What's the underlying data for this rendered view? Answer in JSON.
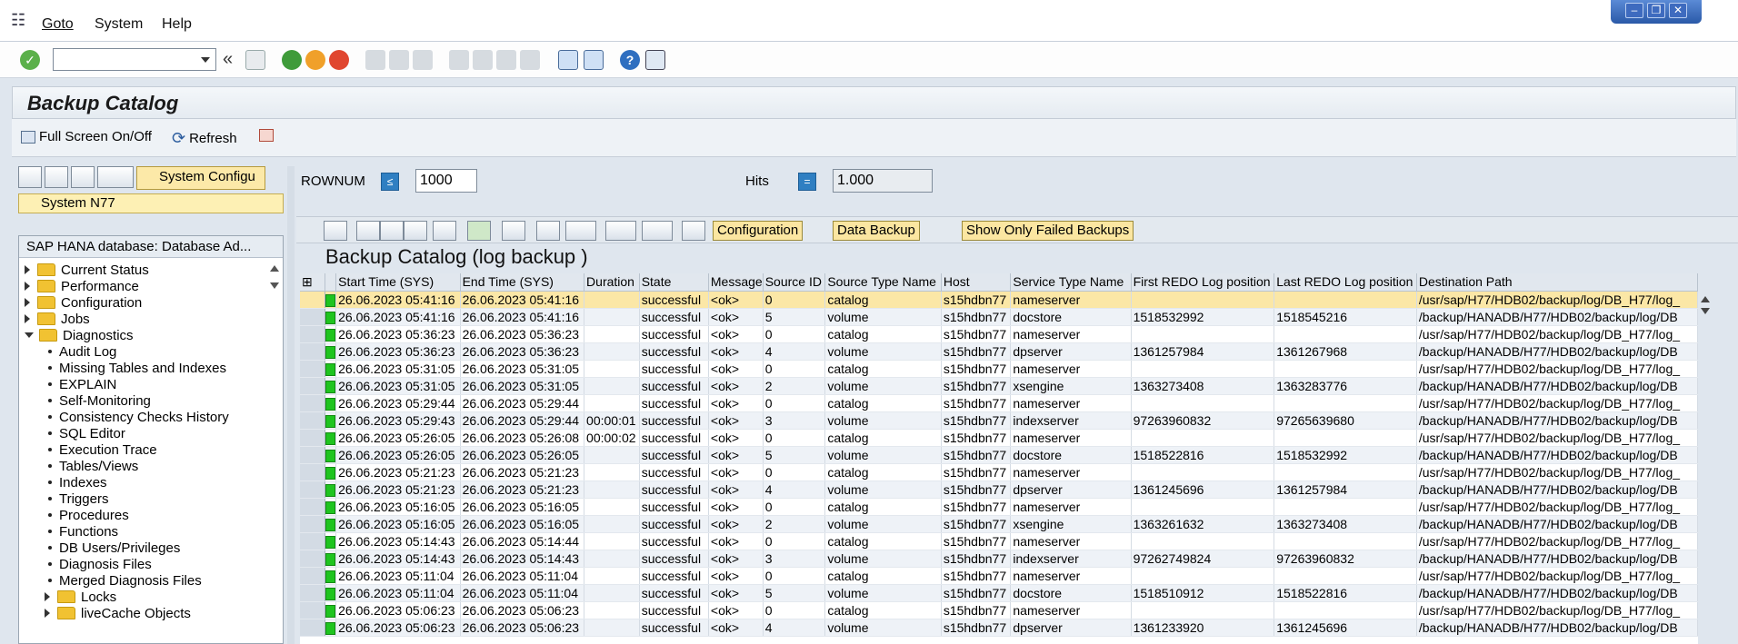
{
  "menubar": {
    "items": [
      "Goto",
      "System",
      "Help"
    ]
  },
  "window": {
    "title": "Backup Catalog"
  },
  "app_toolbar": {
    "fullscreen_label": "Full Screen On/Off",
    "refresh_label": "Refresh"
  },
  "left_pane": {
    "variant_label": "System Configu",
    "system_label": "System N77",
    "tree_header": "SAP HANA database: Database Ad...",
    "nodes": [
      {
        "label": "Current Status",
        "type": "folder"
      },
      {
        "label": "Performance",
        "type": "folder"
      },
      {
        "label": "Configuration",
        "type": "folder"
      },
      {
        "label": "Jobs",
        "type": "folder"
      },
      {
        "label": "Diagnostics",
        "type": "folder-open"
      },
      {
        "label": "Audit Log",
        "type": "leaf"
      },
      {
        "label": "Missing Tables and Indexes",
        "type": "leaf"
      },
      {
        "label": "EXPLAIN",
        "type": "leaf"
      },
      {
        "label": "Self-Monitoring",
        "type": "leaf"
      },
      {
        "label": "Consistency Checks History",
        "type": "leaf"
      },
      {
        "label": "SQL Editor",
        "type": "leaf"
      },
      {
        "label": "Execution Trace",
        "type": "leaf"
      },
      {
        "label": "Tables/Views",
        "type": "leaf"
      },
      {
        "label": "Indexes",
        "type": "leaf"
      },
      {
        "label": "Triggers",
        "type": "leaf"
      },
      {
        "label": "Procedures",
        "type": "leaf"
      },
      {
        "label": "Functions",
        "type": "leaf"
      },
      {
        "label": "DB Users/Privileges",
        "type": "leaf"
      },
      {
        "label": "Diagnosis Files",
        "type": "leaf"
      },
      {
        "label": "Merged Diagnosis Files",
        "type": "leaf"
      },
      {
        "label": "Locks",
        "type": "subfolder"
      },
      {
        "label": "liveCache Objects",
        "type": "subfolder"
      }
    ]
  },
  "filter": {
    "rownum_label": "ROWNUM",
    "rownum_value": "1000",
    "hits_label": "Hits",
    "hits_value": "1.000"
  },
  "grid_toolbar": {
    "configuration": "Configuration",
    "data_backup": "Data Backup",
    "failed_only": "Show Only Failed Backups"
  },
  "grid": {
    "title": "Backup Catalog (log backup )",
    "columns": [
      "Start Time (SYS)",
      "End Time (SYS)",
      "Duration",
      "State",
      "Message",
      "Source ID",
      "Source Type Name",
      "Host",
      "Service Type Name",
      "First REDO Log position",
      "Last REDO Log position",
      "Destination Path"
    ],
    "rows": [
      [
        "26.06.2023 05:41:16",
        "26.06.2023 05:41:16",
        "",
        "successful",
        "<ok>",
        "0",
        "catalog",
        "s15hdbn77",
        "nameserver",
        "",
        "",
        "/usr/sap/H77/HDB02/backup/log/DB_H77/log_"
      ],
      [
        "26.06.2023 05:41:16",
        "26.06.2023 05:41:16",
        "",
        "successful",
        "<ok>",
        "5",
        "volume",
        "s15hdbn77",
        "docstore",
        "1518532992",
        "1518545216",
        "/backup/HANADB/H77/HDB02/backup/log/DB"
      ],
      [
        "26.06.2023 05:36:23",
        "26.06.2023 05:36:23",
        "",
        "successful",
        "<ok>",
        "0",
        "catalog",
        "s15hdbn77",
        "nameserver",
        "",
        "",
        "/usr/sap/H77/HDB02/backup/log/DB_H77/log_"
      ],
      [
        "26.06.2023 05:36:23",
        "26.06.2023 05:36:23",
        "",
        "successful",
        "<ok>",
        "4",
        "volume",
        "s15hdbn77",
        "dpserver",
        "1361257984",
        "1361267968",
        "/backup/HANADB/H77/HDB02/backup/log/DB"
      ],
      [
        "26.06.2023 05:31:05",
        "26.06.2023 05:31:05",
        "",
        "successful",
        "<ok>",
        "0",
        "catalog",
        "s15hdbn77",
        "nameserver",
        "",
        "",
        "/usr/sap/H77/HDB02/backup/log/DB_H77/log_"
      ],
      [
        "26.06.2023 05:31:05",
        "26.06.2023 05:31:05",
        "",
        "successful",
        "<ok>",
        "2",
        "volume",
        "s15hdbn77",
        "xsengine",
        "1363273408",
        "1363283776",
        "/backup/HANADB/H77/HDB02/backup/log/DB"
      ],
      [
        "26.06.2023 05:29:44",
        "26.06.2023 05:29:44",
        "",
        "successful",
        "<ok>",
        "0",
        "catalog",
        "s15hdbn77",
        "nameserver",
        "",
        "",
        "/usr/sap/H77/HDB02/backup/log/DB_H77/log_"
      ],
      [
        "26.06.2023 05:29:43",
        "26.06.2023 05:29:44",
        "00:00:01",
        "successful",
        "<ok>",
        "3",
        "volume",
        "s15hdbn77",
        "indexserver",
        "97263960832",
        "97265639680",
        "/backup/HANADB/H77/HDB02/backup/log/DB"
      ],
      [
        "26.06.2023 05:26:05",
        "26.06.2023 05:26:08",
        "00:00:02",
        "successful",
        "<ok>",
        "0",
        "catalog",
        "s15hdbn77",
        "nameserver",
        "",
        "",
        "/usr/sap/H77/HDB02/backup/log/DB_H77/log_"
      ],
      [
        "26.06.2023 05:26:05",
        "26.06.2023 05:26:05",
        "",
        "successful",
        "<ok>",
        "5",
        "volume",
        "s15hdbn77",
        "docstore",
        "1518522816",
        "1518532992",
        "/backup/HANADB/H77/HDB02/backup/log/DB"
      ],
      [
        "26.06.2023 05:21:23",
        "26.06.2023 05:21:23",
        "",
        "successful",
        "<ok>",
        "0",
        "catalog",
        "s15hdbn77",
        "nameserver",
        "",
        "",
        "/usr/sap/H77/HDB02/backup/log/DB_H77/log_"
      ],
      [
        "26.06.2023 05:21:23",
        "26.06.2023 05:21:23",
        "",
        "successful",
        "<ok>",
        "4",
        "volume",
        "s15hdbn77",
        "dpserver",
        "1361245696",
        "1361257984",
        "/backup/HANADB/H77/HDB02/backup/log/DB"
      ],
      [
        "26.06.2023 05:16:05",
        "26.06.2023 05:16:05",
        "",
        "successful",
        "<ok>",
        "0",
        "catalog",
        "s15hdbn77",
        "nameserver",
        "",
        "",
        "/usr/sap/H77/HDB02/backup/log/DB_H77/log_"
      ],
      [
        "26.06.2023 05:16:05",
        "26.06.2023 05:16:05",
        "",
        "successful",
        "<ok>",
        "2",
        "volume",
        "s15hdbn77",
        "xsengine",
        "1363261632",
        "1363273408",
        "/backup/HANADB/H77/HDB02/backup/log/DB"
      ],
      [
        "26.06.2023 05:14:43",
        "26.06.2023 05:14:44",
        "",
        "successful",
        "<ok>",
        "0",
        "catalog",
        "s15hdbn77",
        "nameserver",
        "",
        "",
        "/usr/sap/H77/HDB02/backup/log/DB_H77/log_"
      ],
      [
        "26.06.2023 05:14:43",
        "26.06.2023 05:14:43",
        "",
        "successful",
        "<ok>",
        "3",
        "volume",
        "s15hdbn77",
        "indexserver",
        "97262749824",
        "97263960832",
        "/backup/HANADB/H77/HDB02/backup/log/DB"
      ],
      [
        "26.06.2023 05:11:04",
        "26.06.2023 05:11:04",
        "",
        "successful",
        "<ok>",
        "0",
        "catalog",
        "s15hdbn77",
        "nameserver",
        "",
        "",
        "/usr/sap/H77/HDB02/backup/log/DB_H77/log_"
      ],
      [
        "26.06.2023 05:11:04",
        "26.06.2023 05:11:04",
        "",
        "successful",
        "<ok>",
        "5",
        "volume",
        "s15hdbn77",
        "docstore",
        "1518510912",
        "1518522816",
        "/backup/HANADB/H77/HDB02/backup/log/DB"
      ],
      [
        "26.06.2023 05:06:23",
        "26.06.2023 05:06:23",
        "",
        "successful",
        "<ok>",
        "0",
        "catalog",
        "s15hdbn77",
        "nameserver",
        "",
        "",
        "/usr/sap/H77/HDB02/backup/log/DB_H77/log_"
      ],
      [
        "26.06.2023 05:06:23",
        "26.06.2023 05:06:23",
        "",
        "successful",
        "<ok>",
        "4",
        "volume",
        "s15hdbn77",
        "dpserver",
        "1361233920",
        "1361245696",
        "/backup/HANADB/H77/HDB02/backup/log/DB"
      ]
    ]
  },
  "colors": {
    "selected_row": "#fbe7a6",
    "status_ok": "#1fc41f"
  }
}
